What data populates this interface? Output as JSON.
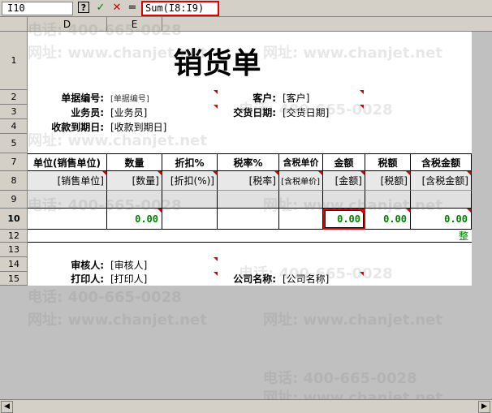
{
  "formula_bar": {
    "name_box": "I10",
    "help": "?",
    "confirm": "✓",
    "cancel": "✕",
    "equals": "=",
    "formula": "Sum(I8:I9)"
  },
  "columns": {
    "d": "D",
    "e": "E"
  },
  "rows": [
    "1",
    "2",
    "3",
    "4",
    "5",
    "7",
    "8",
    "9",
    "10",
    "12",
    "13",
    "14",
    "15"
  ],
  "title": "销货单",
  "header_fields": {
    "doc_no_label": "单据编号:",
    "doc_no_value": "[单据编号]",
    "customer_label": "客户:",
    "customer_value": "[客户]",
    "salesman_label": "业务员:",
    "salesman_value": "[业务员]",
    "trade_date_label": "交货日期:",
    "trade_date_value": "[交货日期]",
    "due_date_label": "收款到期日:",
    "due_date_value": "[收款到期日]"
  },
  "table_headers": [
    "单位(销售单位)",
    "数量",
    "折扣%",
    "税率%",
    "含税单价",
    "金额",
    "税额",
    "含税金额"
  ],
  "table_fields": [
    "[销售单位]",
    "[数量]",
    "[折扣(%)]",
    "[税率]",
    "[含税单价]",
    "[金额]",
    "[税额]",
    "[含税金额]"
  ],
  "totals": {
    "qty": "0.00",
    "amount": "0.00",
    "tax": "0.00",
    "tax_total": "0.00"
  },
  "row12_text": "整",
  "footer_fields": {
    "auditor_label": "审核人:",
    "auditor_value": "[审核人]",
    "printer_label": "打印人:",
    "printer_value": "[打印人]",
    "company_label": "公司名称:",
    "company_value": "[公司名称]"
  },
  "watermark": {
    "phone": "电话: 400-665-0028",
    "site": "网址: www.chanjet.net"
  }
}
